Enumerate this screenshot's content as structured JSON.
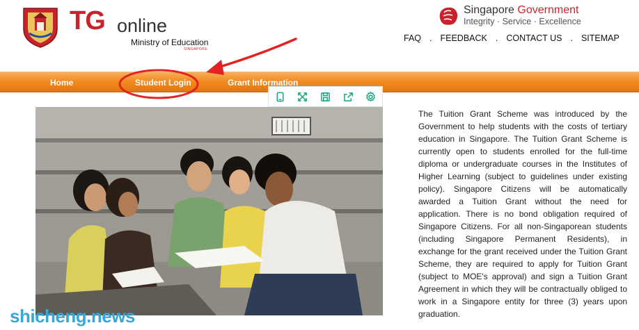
{
  "brand": {
    "tg_mark": "TG",
    "tg_online": "online",
    "ministry": "Ministry of Education",
    "ministry_sub": "SINGAPORE"
  },
  "gov": {
    "title_prefix": "Singapore ",
    "title_highlight": "Government",
    "tagline": "Integrity · Service · Excellence"
  },
  "top_links": [
    "FAQ",
    "FEEDBACK",
    "CONTACT US",
    "SITEMAP"
  ],
  "top_link_separator": ".",
  "nav": {
    "home": "Home",
    "student_login": "Student Login",
    "grant_information": "Grant Information"
  },
  "toolbar_icons": [
    "phone-icon",
    "expand-icon",
    "save-icon",
    "share-icon",
    "settings-icon"
  ],
  "description": "The Tuition Grant Scheme was introduced by the Government to help students with the costs of tertiary education in Singapore. The Tuition Grant Scheme is currently open to students enrolled for the full-time diploma or undergraduate courses in the Institutes of Higher Learning (subject to guidelines under existing policy). Singapore Citizens will be automatically awarded a Tuition Grant without the need for application. There is no bond obligation required of Singapore Citizens. For all non-Singaporean students (including Singapore Permanent Residents), in exchange for the grant received under the Tuition Grant Scheme, they are required to apply for Tuition Grant (subject to MOE's approval) and sign a Tuition Grant Agreement in which they will be contractually obliged to work in a Singapore entity for three (3) years upon graduation.",
  "watermark": "shicheng.news",
  "colors": {
    "brand_red": "#c8232c",
    "nav_orange": "#f28c22",
    "toolbar_green": "#1aa383",
    "annotation_red": "#e32222",
    "watermark_blue": "#35a8d9"
  }
}
